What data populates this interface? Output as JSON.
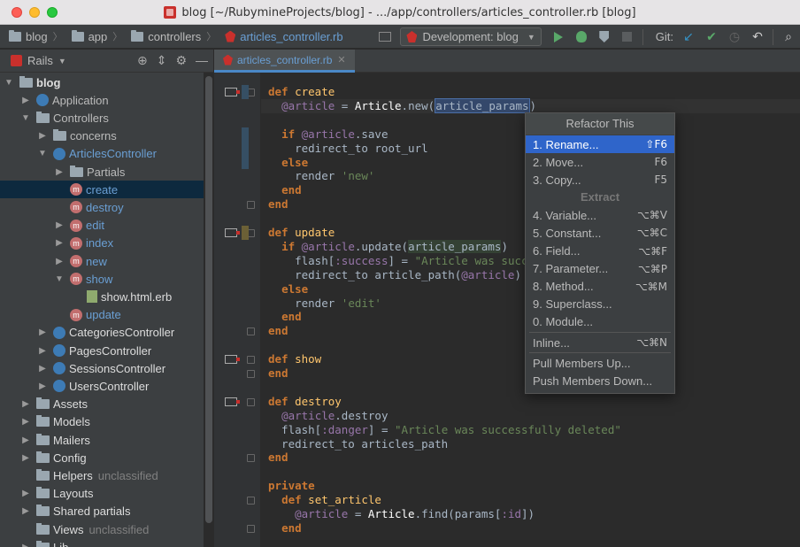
{
  "window": {
    "title": "blog [~/RubymineProjects/blog] - .../app/controllers/articles_controller.rb [blog]"
  },
  "breadcrumb": [
    "blog",
    "app",
    "controllers",
    "articles_controller.rb"
  ],
  "toolbar": {
    "run_config": "Development: blog",
    "git_label": "Git:"
  },
  "project_panel": {
    "view_label": "Rails"
  },
  "tree": [
    {
      "label": "blog",
      "depth": 0,
      "arrow": "▼",
      "icon": "folder",
      "style": "bold"
    },
    {
      "label": "Application",
      "depth": 1,
      "arrow": "▶",
      "icon": "ctrl",
      "style": ""
    },
    {
      "label": "Controllers",
      "depth": 1,
      "arrow": "▼",
      "icon": "folder",
      "style": ""
    },
    {
      "label": "concerns",
      "depth": 2,
      "arrow": "▶",
      "icon": "folder",
      "style": ""
    },
    {
      "label": "ArticlesController",
      "depth": 2,
      "arrow": "▼",
      "icon": "ctrl",
      "style": "blue"
    },
    {
      "label": "Partials",
      "depth": 3,
      "arrow": "▶",
      "icon": "folder",
      "style": ""
    },
    {
      "label": "create",
      "depth": 3,
      "arrow": "",
      "icon": "method",
      "style": "blue",
      "selected": true
    },
    {
      "label": "destroy",
      "depth": 3,
      "arrow": "",
      "icon": "method",
      "style": "blue"
    },
    {
      "label": "edit",
      "depth": 3,
      "arrow": "▶",
      "icon": "method",
      "style": "blue"
    },
    {
      "label": "index",
      "depth": 3,
      "arrow": "▶",
      "icon": "method",
      "style": "blue"
    },
    {
      "label": "new",
      "depth": 3,
      "arrow": "▶",
      "icon": "method",
      "style": "blue"
    },
    {
      "label": "show",
      "depth": 3,
      "arrow": "▼",
      "icon": "method",
      "style": "blue"
    },
    {
      "label": "show.html.erb",
      "depth": 4,
      "arrow": "",
      "icon": "erb",
      "style": "white"
    },
    {
      "label": "update",
      "depth": 3,
      "arrow": "",
      "icon": "method",
      "style": "blue"
    },
    {
      "label": "CategoriesController",
      "depth": 2,
      "arrow": "▶",
      "icon": "ctrl",
      "style": "white"
    },
    {
      "label": "PagesController",
      "depth": 2,
      "arrow": "▶",
      "icon": "ctrl",
      "style": "white"
    },
    {
      "label": "SessionsController",
      "depth": 2,
      "arrow": "▶",
      "icon": "ctrl",
      "style": "white"
    },
    {
      "label": "UsersController",
      "depth": 2,
      "arrow": "▶",
      "icon": "ctrl",
      "style": "white"
    },
    {
      "label": "Assets",
      "depth": 1,
      "arrow": "▶",
      "icon": "folder",
      "style": "white"
    },
    {
      "label": "Models",
      "depth": 1,
      "arrow": "▶",
      "icon": "folder",
      "style": "white"
    },
    {
      "label": "Mailers",
      "depth": 1,
      "arrow": "▶",
      "icon": "folder",
      "style": "white"
    },
    {
      "label": "Config",
      "depth": 1,
      "arrow": "▶",
      "icon": "folder",
      "style": "white"
    },
    {
      "label": "Helpers",
      "depth": 1,
      "arrow": "",
      "icon": "folder",
      "style": "white",
      "note": "unclassified"
    },
    {
      "label": "Layouts",
      "depth": 1,
      "arrow": "▶",
      "icon": "folder",
      "style": "white"
    },
    {
      "label": "Shared partials",
      "depth": 1,
      "arrow": "▶",
      "icon": "folder",
      "style": "white"
    },
    {
      "label": "Views",
      "depth": 1,
      "arrow": "",
      "icon": "folder",
      "style": "white",
      "note": "unclassified"
    },
    {
      "label": "Lib",
      "depth": 1,
      "arrow": "▶",
      "icon": "folder",
      "style": "white"
    }
  ],
  "editor": {
    "tab_label": "articles_controller.rb",
    "lines": [
      {
        "indent": 0,
        "html": "<span class=\"kw\">def </span><span class=\"fn\">create</span>"
      },
      {
        "indent": 1,
        "html": "<span class=\"iv\">@article</span> = <span class=\"cls\">Article</span>.new(<span class=\"hl\">article_params</span>)",
        "current": true
      },
      {
        "indent": 0,
        "html": ""
      },
      {
        "indent": 1,
        "html": "<span class=\"kw\">if </span><span class=\"iv\">@article</span>.save"
      },
      {
        "indent": 2,
        "html": "redirect_to root_url"
      },
      {
        "indent": 1,
        "html": "<span class=\"kw\">else</span>"
      },
      {
        "indent": 2,
        "html": "render <span class=\"str\">'new'</span>"
      },
      {
        "indent": 1,
        "html": "<span class=\"kw\">end</span>"
      },
      {
        "indent": 0,
        "html": "<span class=\"kw\">end</span>"
      },
      {
        "indent": 0,
        "html": ""
      },
      {
        "indent": 0,
        "html": "<span class=\"kw\">def </span><span class=\"fn\">update</span>"
      },
      {
        "indent": 1,
        "html": "<span class=\"kw\">if </span><span class=\"iv\">@article</span>.update(<span class=\"hl2\">article_params</span>)"
      },
      {
        "indent": 2,
        "html": "flash[<span class=\"sym\">:success</span>] = <span class=\"str\">\"Article was succ</span>"
      },
      {
        "indent": 2,
        "html": "redirect_to article_path(<span class=\"iv\">@article</span>)"
      },
      {
        "indent": 1,
        "html": "<span class=\"kw\">else</span>"
      },
      {
        "indent": 2,
        "html": "render <span class=\"str\">'edit'</span>"
      },
      {
        "indent": 1,
        "html": "<span class=\"kw\">end</span>"
      },
      {
        "indent": 0,
        "html": "<span class=\"kw\">end</span>"
      },
      {
        "indent": 0,
        "html": ""
      },
      {
        "indent": 0,
        "html": "<span class=\"kw\">def </span><span class=\"fn\">show</span>"
      },
      {
        "indent": 0,
        "html": "<span class=\"kw\">end</span>"
      },
      {
        "indent": 0,
        "html": ""
      },
      {
        "indent": 0,
        "html": "<span class=\"kw\">def </span><span class=\"fn\">destroy</span>"
      },
      {
        "indent": 1,
        "html": "<span class=\"iv\">@article</span>.destroy"
      },
      {
        "indent": 1,
        "html": "flash[<span class=\"sym\">:danger</span>] = <span class=\"str\">\"Article was successfully deleted\"</span>"
      },
      {
        "indent": 1,
        "html": "redirect_to articles_path"
      },
      {
        "indent": 0,
        "html": "<span class=\"kw\">end</span>"
      },
      {
        "indent": 0,
        "html": ""
      },
      {
        "indent": 0,
        "html": "<span class=\"kw\">private</span>"
      },
      {
        "indent": 1,
        "html": "<span class=\"kw\">def </span><span class=\"fn\">set_article</span>"
      },
      {
        "indent": 2,
        "html": "<span class=\"iv\">@article</span> = <span class=\"cls\">Article</span>.find(params[<span class=\"sym\">:id</span>])"
      },
      {
        "indent": 1,
        "html": "<span class=\"kw\">end</span>"
      }
    ]
  },
  "refactor_popup": {
    "title": "Refactor This",
    "items": [
      {
        "label": "1. Rename...",
        "shortcut": "⇧F6",
        "active": true
      },
      {
        "label": "2. Move...",
        "shortcut": "F6"
      },
      {
        "label": "3. Copy...",
        "shortcut": "F5"
      },
      {
        "section": "Extract"
      },
      {
        "label": "4. Variable...",
        "shortcut": "⌥⌘V"
      },
      {
        "label": "5. Constant...",
        "shortcut": "⌥⌘C"
      },
      {
        "label": "6. Field...",
        "shortcut": "⌥⌘F"
      },
      {
        "label": "7. Parameter...",
        "shortcut": "⌥⌘P"
      },
      {
        "label": "8. Method...",
        "shortcut": "⌥⌘M"
      },
      {
        "label": "9. Superclass...",
        "shortcut": ""
      },
      {
        "label": "0. Module...",
        "shortcut": ""
      },
      {
        "separator": true
      },
      {
        "label": "Inline...",
        "shortcut": "⌥⌘N"
      },
      {
        "separator": true
      },
      {
        "label": "Pull Members Up...",
        "shortcut": ""
      },
      {
        "label": "Push Members Down...",
        "shortcut": ""
      }
    ]
  }
}
